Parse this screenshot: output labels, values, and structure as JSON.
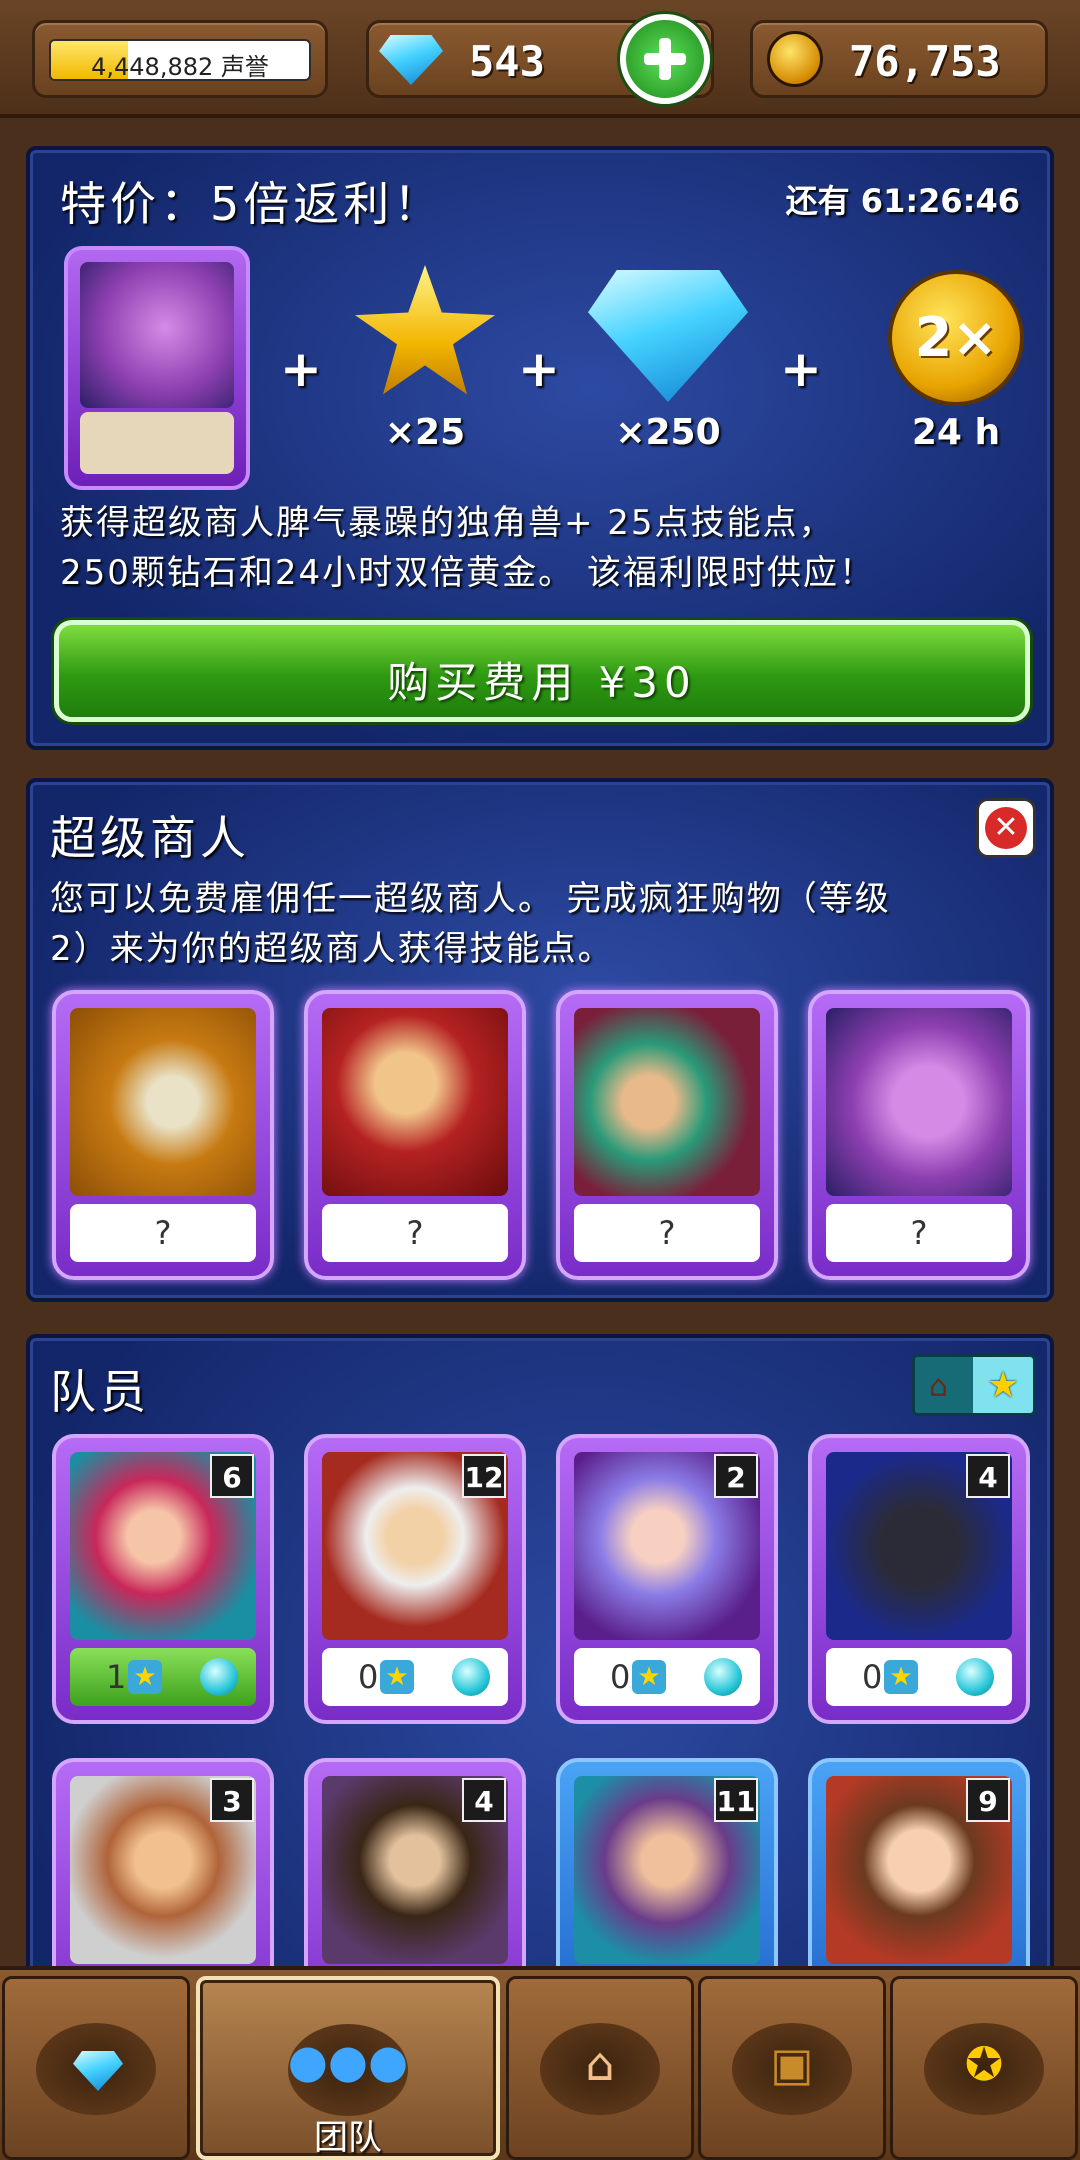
{
  "topbar": {
    "reputation_text": "4,448,882 声誉",
    "reputation_progress": 0.3,
    "gems": "543",
    "gold": "76,753"
  },
  "offer": {
    "title": "特价：5倍返利！",
    "timer": "还有 61:26:46",
    "rewards": [
      {
        "icon": "unicorn-card",
        "label": ""
      },
      {
        "icon": "star-icon",
        "label": "×25"
      },
      {
        "icon": "gem-icon",
        "label": "×250"
      },
      {
        "icon": "double-gold-coin-icon",
        "label": "24 h",
        "badge": "2×"
      }
    ],
    "plus_sign": "+",
    "description_line1": "获得超级商人脾气暴躁的独角兽+ 25点技能点，",
    "description_line2": "250颗钻石和24小时双倍黄金。 该福利限时供应！",
    "buy_label": "购买费用 ¥30"
  },
  "super_merchant": {
    "title": "超级商人",
    "text_line1": "您可以免费雇佣任一超级商人。 完成疯狂购物（等级",
    "text_line2": "2）来为你的超级商人获得技能点。",
    "cards": [
      {
        "name": "skeleton",
        "label": "?"
      },
      {
        "name": "gentleman",
        "label": "?"
      },
      {
        "name": "sage",
        "label": "?"
      },
      {
        "name": "unicorn",
        "label": "?"
      }
    ]
  },
  "team": {
    "title": "队员",
    "members": [
      {
        "name": "elf-alchemist",
        "level": "6",
        "stars": "1",
        "active": true
      },
      {
        "name": "chef",
        "level": "12",
        "stars": "0",
        "active": false
      },
      {
        "name": "fairy",
        "level": "2",
        "stars": "0",
        "active": false
      },
      {
        "name": "dark-unicorn",
        "level": "4",
        "stars": "0",
        "active": false
      },
      {
        "name": "lumberjack",
        "level": "3"
      },
      {
        "name": "hippie",
        "level": "4"
      },
      {
        "name": "barbarian",
        "level": "11"
      },
      {
        "name": "baker",
        "level": "9"
      }
    ]
  },
  "nav": {
    "tabs": [
      {
        "icon": "gems-icon",
        "label": ""
      },
      {
        "icon": "team-icon",
        "label": "团队"
      },
      {
        "icon": "buildings-icon",
        "label": ""
      },
      {
        "icon": "treasure-chest-icon",
        "label": ""
      },
      {
        "icon": "medal-icon",
        "label": ""
      }
    ]
  },
  "colors": {
    "panel_blue": "#13266a",
    "buy_green": "#2f9a12",
    "card_purple": "#7a2cc8",
    "wood": "#6a4220"
  }
}
